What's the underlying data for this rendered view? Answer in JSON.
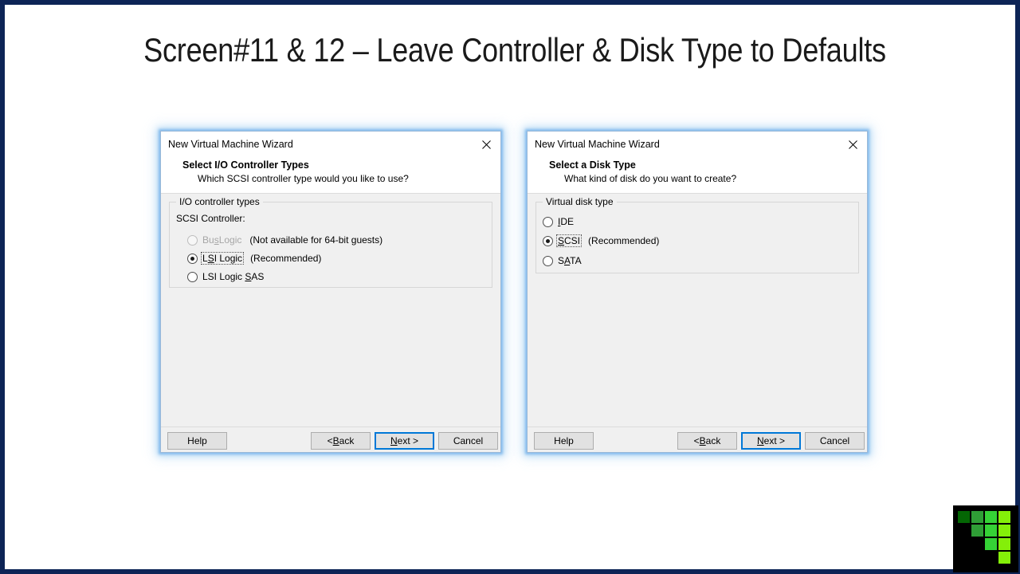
{
  "slide": {
    "title": "Screen#11 & 12 – Leave Controller & Disk Type to Defaults",
    "border_color": "#0d2456",
    "background_color": "#ffffff"
  },
  "dialogs": [
    {
      "id": "io-controller",
      "titlebar": "New Virtual Machine Wizard",
      "close_icon": "close-icon",
      "heading": "Select I/O Controller Types",
      "subheading": "Which SCSI controller type would you like to use?",
      "groupbox_legend": "I/O controller types",
      "field_label": "SCSI Controller:",
      "options": [
        {
          "label_pre": "Bu",
          "label_accel": "s",
          "label_post": "Logic",
          "note": "(Not available for 64-bit guests)",
          "checked": false,
          "disabled": true,
          "focused": false
        },
        {
          "label_pre": "L",
          "label_accel": "S",
          "label_post": "I Logic",
          "note": "(Recommended)",
          "checked": true,
          "disabled": false,
          "focused": true
        },
        {
          "label_pre": "LSI Logic ",
          "label_accel": "S",
          "label_post": "AS",
          "note": "",
          "checked": false,
          "disabled": false,
          "focused": false
        }
      ],
      "buttons": {
        "help": "Help",
        "back_pre": "< ",
        "back_accel": "B",
        "back_post": "ack",
        "next_pre": "",
        "next_accel": "N",
        "next_post": "ext >",
        "cancel": "Cancel"
      }
    },
    {
      "id": "disk-type",
      "titlebar": "New Virtual Machine Wizard",
      "close_icon": "close-icon",
      "heading": "Select a Disk Type",
      "subheading": "What kind of disk do you want to create?",
      "groupbox_legend": "Virtual disk type",
      "field_label": "",
      "options": [
        {
          "label_pre": "",
          "label_accel": "I",
          "label_post": "DE",
          "note": "",
          "checked": false,
          "disabled": false,
          "focused": false
        },
        {
          "label_pre": "",
          "label_accel": "S",
          "label_post": "CSI",
          "note": "(Recommended)",
          "checked": true,
          "disabled": false,
          "focused": true
        },
        {
          "label_pre": "S",
          "label_accel": "A",
          "label_post": "TA",
          "note": "",
          "checked": false,
          "disabled": false,
          "focused": false
        }
      ],
      "buttons": {
        "help": "Help",
        "back_pre": "< ",
        "back_accel": "B",
        "back_post": "ack",
        "next_pre": "",
        "next_accel": "N",
        "next_post": "ext >",
        "cancel": "Cancel"
      }
    }
  ],
  "logo": {
    "name": "green-pixel-staircase-logo",
    "background": "#000000",
    "column_colors": [
      "#046604",
      "#2f9e36",
      "#35d236",
      "#84ef09"
    ],
    "cells": [
      {
        "col": 0,
        "row": 0
      },
      {
        "col": 1,
        "row": 0
      },
      {
        "col": 2,
        "row": 0
      },
      {
        "col": 3,
        "row": 0
      },
      {
        "col": 1,
        "row": 1
      },
      {
        "col": 2,
        "row": 1
      },
      {
        "col": 3,
        "row": 1
      },
      {
        "col": 2,
        "row": 2
      },
      {
        "col": 3,
        "row": 2
      },
      {
        "col": 3,
        "row": 3
      }
    ]
  },
  "theme": {
    "dialog_focus_blue": "#0078d7",
    "dialog_glow_blue": "#78b4eb",
    "button_face": "#e1e1e1",
    "body_gray": "#f0f0f0"
  }
}
